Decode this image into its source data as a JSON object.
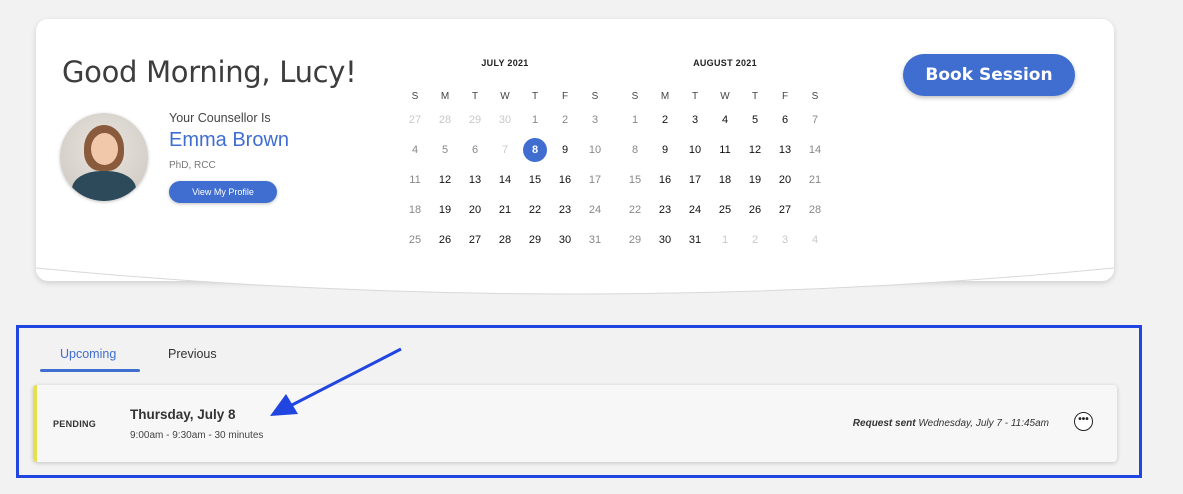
{
  "greeting": "Good Morning, Lucy!",
  "counsellor": {
    "label": "Your Counsellor Is",
    "name": "Emma Brown",
    "credentials": "PhD, RCC",
    "profile_button": "View My Profile"
  },
  "book_button": "Book Session",
  "calendars": [
    {
      "title": "JULY 2021",
      "dow": [
        "S",
        "M",
        "T",
        "W",
        "T",
        "F",
        "S"
      ],
      "days": [
        {
          "d": "27",
          "s": "muted"
        },
        {
          "d": "28",
          "s": "muted"
        },
        {
          "d": "29",
          "s": "muted"
        },
        {
          "d": "30",
          "s": "muted"
        },
        {
          "d": "1",
          "s": "grey"
        },
        {
          "d": "2",
          "s": "grey"
        },
        {
          "d": "3",
          "s": "grey"
        },
        {
          "d": "4",
          "s": "grey"
        },
        {
          "d": "5",
          "s": "grey"
        },
        {
          "d": "6",
          "s": "grey"
        },
        {
          "d": "7",
          "s": "muted"
        },
        {
          "d": "8",
          "s": "selected"
        },
        {
          "d": "9",
          "s": ""
        },
        {
          "d": "10",
          "s": "grey"
        },
        {
          "d": "11",
          "s": "grey"
        },
        {
          "d": "12",
          "s": ""
        },
        {
          "d": "13",
          "s": ""
        },
        {
          "d": "14",
          "s": ""
        },
        {
          "d": "15",
          "s": ""
        },
        {
          "d": "16",
          "s": ""
        },
        {
          "d": "17",
          "s": "grey"
        },
        {
          "d": "18",
          "s": "grey"
        },
        {
          "d": "19",
          "s": ""
        },
        {
          "d": "20",
          "s": ""
        },
        {
          "d": "21",
          "s": ""
        },
        {
          "d": "22",
          "s": ""
        },
        {
          "d": "23",
          "s": ""
        },
        {
          "d": "24",
          "s": "grey"
        },
        {
          "d": "25",
          "s": "grey"
        },
        {
          "d": "26",
          "s": ""
        },
        {
          "d": "27",
          "s": ""
        },
        {
          "d": "28",
          "s": ""
        },
        {
          "d": "29",
          "s": ""
        },
        {
          "d": "30",
          "s": ""
        },
        {
          "d": "31",
          "s": "grey"
        }
      ]
    },
    {
      "title": "AUGUST 2021",
      "dow": [
        "S",
        "M",
        "T",
        "W",
        "T",
        "F",
        "S"
      ],
      "days": [
        {
          "d": "1",
          "s": "grey"
        },
        {
          "d": "2",
          "s": ""
        },
        {
          "d": "3",
          "s": ""
        },
        {
          "d": "4",
          "s": ""
        },
        {
          "d": "5",
          "s": ""
        },
        {
          "d": "6",
          "s": ""
        },
        {
          "d": "7",
          "s": "grey"
        },
        {
          "d": "8",
          "s": "grey"
        },
        {
          "d": "9",
          "s": ""
        },
        {
          "d": "10",
          "s": ""
        },
        {
          "d": "11",
          "s": ""
        },
        {
          "d": "12",
          "s": ""
        },
        {
          "d": "13",
          "s": ""
        },
        {
          "d": "14",
          "s": "grey"
        },
        {
          "d": "15",
          "s": "grey"
        },
        {
          "d": "16",
          "s": ""
        },
        {
          "d": "17",
          "s": ""
        },
        {
          "d": "18",
          "s": ""
        },
        {
          "d": "19",
          "s": ""
        },
        {
          "d": "20",
          "s": ""
        },
        {
          "d": "21",
          "s": "grey"
        },
        {
          "d": "22",
          "s": "grey"
        },
        {
          "d": "23",
          "s": ""
        },
        {
          "d": "24",
          "s": ""
        },
        {
          "d": "25",
          "s": ""
        },
        {
          "d": "26",
          "s": ""
        },
        {
          "d": "27",
          "s": ""
        },
        {
          "d": "28",
          "s": "grey"
        },
        {
          "d": "29",
          "s": "grey"
        },
        {
          "d": "30",
          "s": ""
        },
        {
          "d": "31",
          "s": ""
        },
        {
          "d": "1",
          "s": "muted"
        },
        {
          "d": "2",
          "s": "muted"
        },
        {
          "d": "3",
          "s": "muted"
        },
        {
          "d": "4",
          "s": "muted"
        }
      ]
    }
  ],
  "tabs": {
    "upcoming": "Upcoming",
    "previous": "Previous"
  },
  "appointment": {
    "status": "PENDING",
    "date": "Thursday, July 8",
    "time": "9:00am - 9:30am - 30 minutes",
    "request_label": "Request sent",
    "request_value": "Wednesday, July 7 - 11:45am",
    "more_icon": "more-icon"
  },
  "colors": {
    "accent": "#3f6ed0",
    "annotation": "#2045e0",
    "pending": "#e6e04a"
  }
}
